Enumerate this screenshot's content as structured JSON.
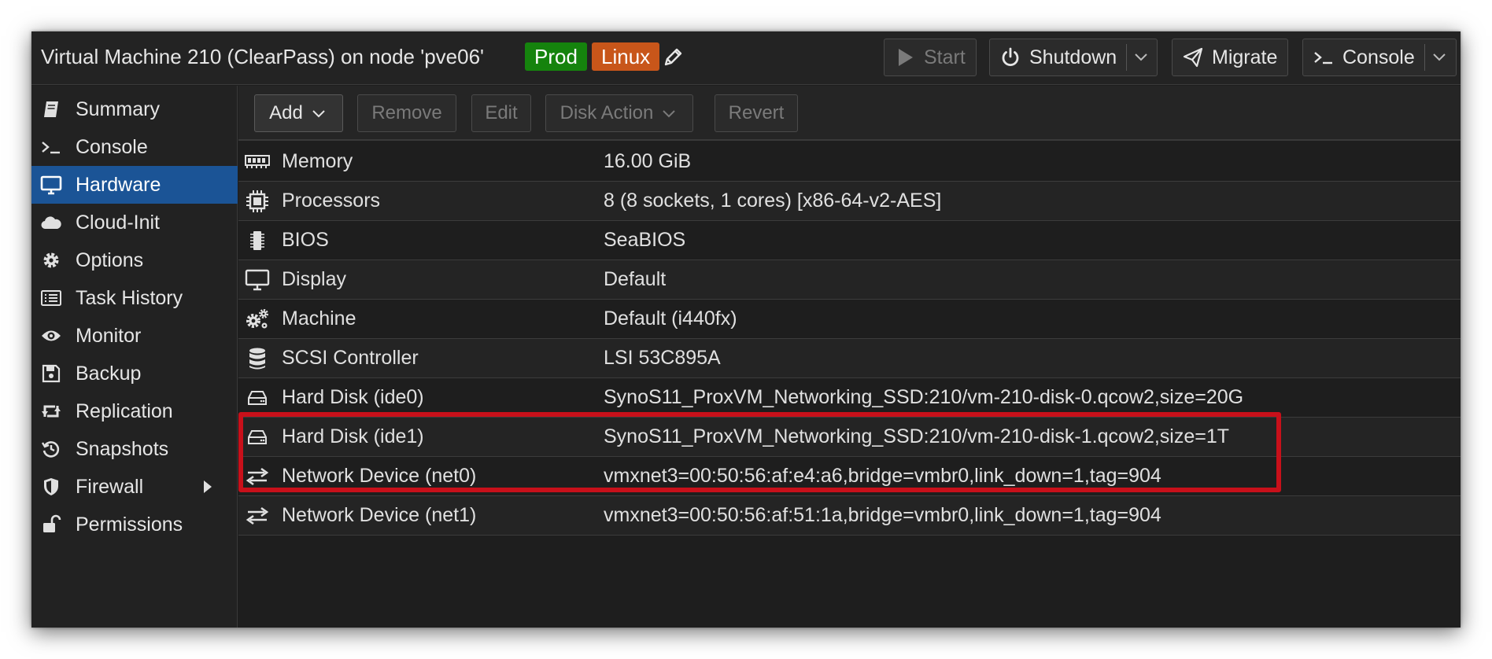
{
  "window": {
    "title": "Virtual Machine 210 (ClearPass) on node 'pve06'",
    "tags": [
      {
        "label": "Prod",
        "color": "#15830d"
      },
      {
        "label": "Linux",
        "color": "#c8561a"
      }
    ],
    "actions": {
      "start": "Start",
      "shutdown": "Shutdown",
      "migrate": "Migrate",
      "console": "Console"
    }
  },
  "sidebar": {
    "items": [
      {
        "label": "Summary",
        "icon": "book-icon"
      },
      {
        "label": "Console",
        "icon": "terminal-icon"
      },
      {
        "label": "Hardware",
        "icon": "monitor-icon",
        "active": true
      },
      {
        "label": "Cloud-Init",
        "icon": "cloud-icon"
      },
      {
        "label": "Options",
        "icon": "gear-icon"
      },
      {
        "label": "Task History",
        "icon": "list-icon"
      },
      {
        "label": "Monitor",
        "icon": "eye-icon"
      },
      {
        "label": "Backup",
        "icon": "floppy-icon"
      },
      {
        "label": "Replication",
        "icon": "retweet-icon"
      },
      {
        "label": "Snapshots",
        "icon": "history-icon"
      },
      {
        "label": "Firewall",
        "icon": "shield-icon"
      },
      {
        "label": "Permissions",
        "icon": "unlock-icon"
      }
    ]
  },
  "toolbar": {
    "add": "Add",
    "remove": "Remove",
    "edit": "Edit",
    "disk_action": "Disk Action",
    "revert": "Revert"
  },
  "hardware": [
    {
      "name": "Memory",
      "value": "16.00 GiB",
      "icon": "memory-icon"
    },
    {
      "name": "Processors",
      "value": "8 (8 sockets, 1 cores) [x86-64-v2-AES]",
      "icon": "cpu-icon"
    },
    {
      "name": "BIOS",
      "value": "SeaBIOS",
      "icon": "microchip-icon"
    },
    {
      "name": "Display",
      "value": "Default",
      "icon": "desktop-icon"
    },
    {
      "name": "Machine",
      "value": "Default (i440fx)",
      "icon": "cogs-icon"
    },
    {
      "name": "SCSI Controller",
      "value": "LSI 53C895A",
      "icon": "database-icon"
    },
    {
      "name": "Hard Disk (ide0)",
      "value": "SynoS11_ProxVM_Networking_SSD:210/vm-210-disk-0.qcow2,size=20G",
      "icon": "hdd-icon"
    },
    {
      "name": "Hard Disk (ide1)",
      "value": "SynoS11_ProxVM_Networking_SSD:210/vm-210-disk-1.qcow2,size=1T",
      "icon": "hdd-icon"
    },
    {
      "name": "Network Device (net0)",
      "value": "vmxnet3=00:50:56:af:e4:a6,bridge=vmbr0,link_down=1,tag=904",
      "icon": "exchange-icon"
    },
    {
      "name": "Network Device (net1)",
      "value": "vmxnet3=00:50:56:af:51:1a,bridge=vmbr0,link_down=1,tag=904",
      "icon": "exchange-icon"
    }
  ],
  "highlight_color": "#c8101a"
}
